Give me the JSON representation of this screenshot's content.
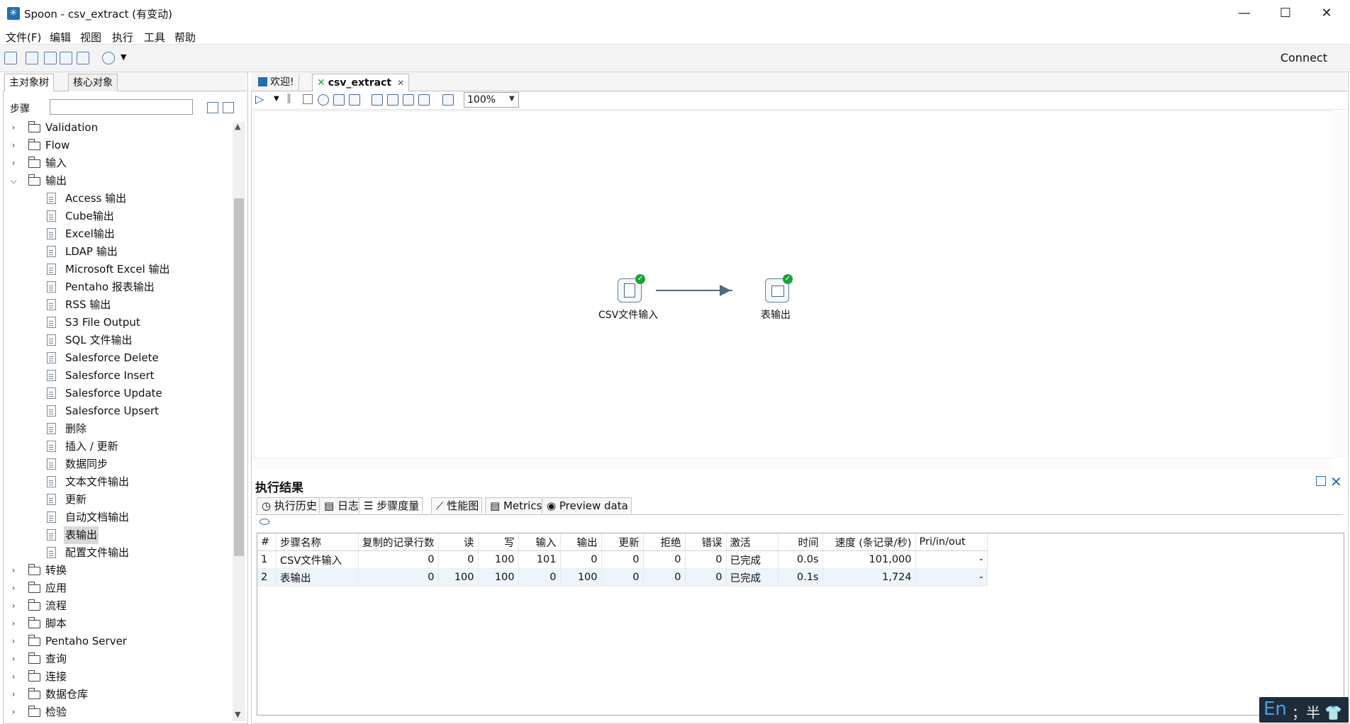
{
  "window": {
    "title": "Spoon - csv_extract (有变动)",
    "app_icon": "spoon-icon",
    "minimize": "—",
    "maximize": "☐",
    "close": "✕"
  },
  "menu": [
    "文件(F)",
    "编辑",
    "视图",
    "执行",
    "工具",
    "帮助"
  ],
  "toolbar": {
    "connect_label": "Connect"
  },
  "left": {
    "tabs": [
      "主对象树",
      "核心对象"
    ],
    "steps_label": "步骤",
    "search_placeholder": "",
    "tree": [
      {
        "label": "Validation",
        "expanded": false
      },
      {
        "label": "Flow",
        "expanded": false
      },
      {
        "label": "输入",
        "expanded": false
      },
      {
        "label": "输出",
        "expanded": true,
        "children": [
          "Access 输出",
          "Cube输出",
          "Excel输出",
          "LDAP 输出",
          "Microsoft Excel 输出",
          "Pentaho 报表输出",
          "RSS 输出",
          "S3 File Output",
          "SQL 文件输出",
          "Salesforce Delete",
          "Salesforce Insert",
          "Salesforce Update",
          "Salesforce Upsert",
          "删除",
          "插入 / 更新",
          "数据同步",
          "文本文件输出",
          "更新",
          "自动文档输出",
          "表输出",
          "配置文件输出"
        ]
      },
      {
        "label": "转换",
        "expanded": false
      },
      {
        "label": "应用",
        "expanded": false
      },
      {
        "label": "流程",
        "expanded": false
      },
      {
        "label": "脚本",
        "expanded": false
      },
      {
        "label": "Pentaho Server",
        "expanded": false
      },
      {
        "label": "查询",
        "expanded": false
      },
      {
        "label": "连接",
        "expanded": false
      },
      {
        "label": "数据仓库",
        "expanded": false
      },
      {
        "label": "检验",
        "expanded": false
      }
    ],
    "selected_leaf": "表输出"
  },
  "editor": {
    "tabs": [
      {
        "label": "欢迎!"
      },
      {
        "label": "csv_extract",
        "active": true
      }
    ],
    "zoom": "100%",
    "nodes": [
      {
        "label": "CSV文件输入",
        "status": "ok"
      },
      {
        "label": "表输出",
        "status": "ok"
      }
    ]
  },
  "results": {
    "title": "执行结果",
    "tabs": [
      "执行历史",
      "日志",
      "步骤度量",
      "性能图",
      "Metrics",
      "Preview data"
    ],
    "active_tab": "步骤度量",
    "columns": [
      "#",
      "步骤名称",
      "复制的记录行数",
      "读",
      "写",
      "输入",
      "输出",
      "更新",
      "拒绝",
      "错误",
      "激活",
      "时间",
      "速度 (条记录/秒)",
      "Pri/in/out"
    ],
    "rows": [
      [
        "1",
        "CSV文件输入",
        "0",
        "0",
        "100",
        "101",
        "0",
        "0",
        "0",
        "0",
        "已完成",
        "0.0s",
        "101,000",
        "-"
      ],
      [
        "2",
        "表输出",
        "0",
        "100",
        "100",
        "0",
        "100",
        "0",
        "0",
        "0",
        "已完成",
        "0.1s",
        "1,724",
        "-"
      ]
    ]
  },
  "ime": {
    "lang": "En",
    "rest": "；半 👕"
  }
}
